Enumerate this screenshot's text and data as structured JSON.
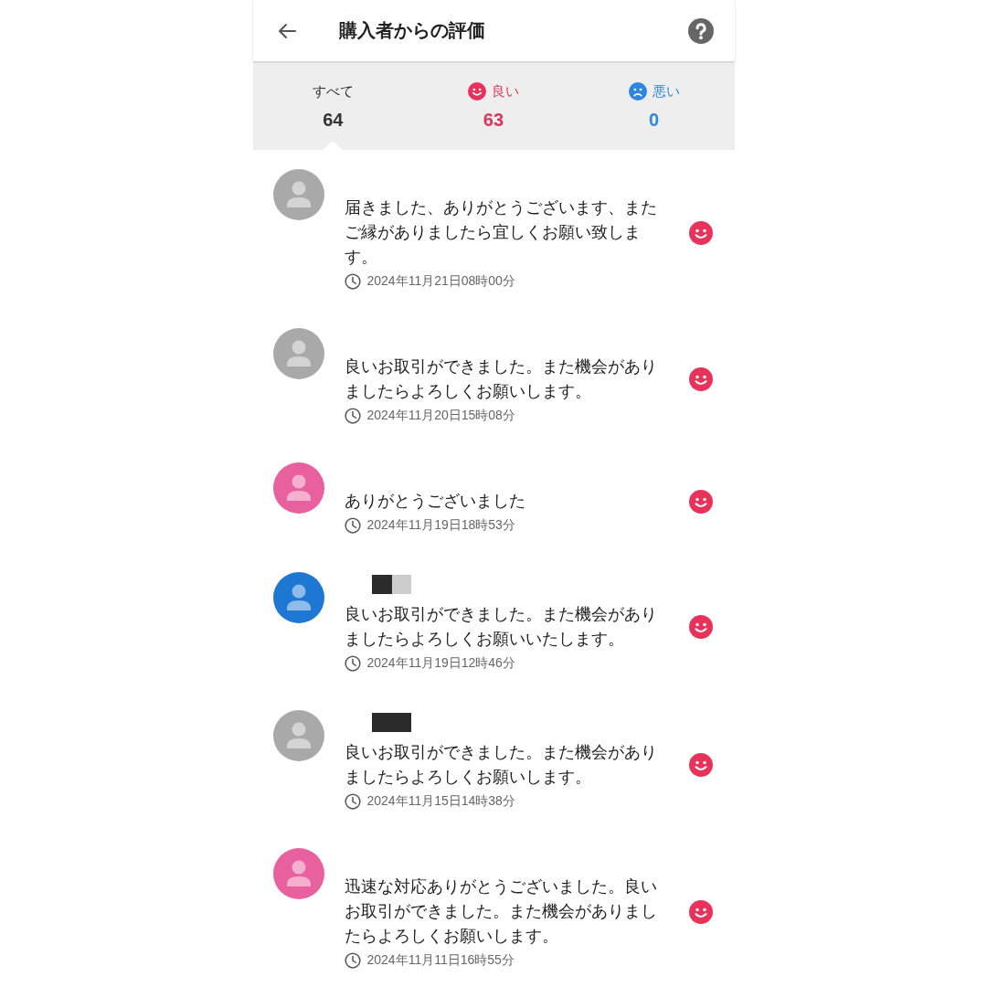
{
  "header": {
    "title": "購入者からの評価"
  },
  "tabs": [
    {
      "kind": "all",
      "label": "すべて",
      "count": "64",
      "selected": true
    },
    {
      "kind": "good",
      "label": "良い",
      "count": "63",
      "selected": false
    },
    {
      "kind": "bad",
      "label": "悪い",
      "count": "0",
      "selected": false
    }
  ],
  "reviews": [
    {
      "avatar": {
        "color": "#a9a9a9"
      },
      "comment": "届きました、ありがとうございます、またご縁がありましたら宜しくお願い致します。",
      "date": "2024年11月21日08時00分",
      "rating": {
        "kind": "good"
      }
    },
    {
      "avatar": {
        "color": "#a9a9a9"
      },
      "comment": "良いお取引ができました。また機会がありましたらよろしくお願いします。",
      "date": "2024年11月20日15時08分",
      "rating": {
        "kind": "good"
      }
    },
    {
      "avatar": {
        "color": "#e8609e"
      },
      "comment": "ありがとうございました",
      "date": "2024年11月19日18時53分",
      "rating": {
        "kind": "good"
      }
    },
    {
      "avatar": {
        "color": "#1e77d2"
      },
      "redaction": {
        "kind": "dark-light"
      },
      "comment": "良いお取引ができました。また機会がありましたらよろしくお願いいたします。",
      "date": "2024年11月19日12時46分",
      "rating": {
        "kind": "good"
      }
    },
    {
      "avatar": {
        "color": "#a9a9a9"
      },
      "redaction": {
        "kind": "dark"
      },
      "comment": "良いお取引ができました。また機会がありましたらよろしくお願いします。",
      "date": "2024年11月15日14時38分",
      "rating": {
        "kind": "good"
      }
    },
    {
      "avatar": {
        "color": "#e8609e"
      },
      "comment": "迅速な対応ありがとうございました。良いお取引ができました。また機会がありましたらよろしくお願いします。",
      "date": "2024年11月11日16時55分",
      "rating": {
        "kind": "good"
      }
    }
  ]
}
